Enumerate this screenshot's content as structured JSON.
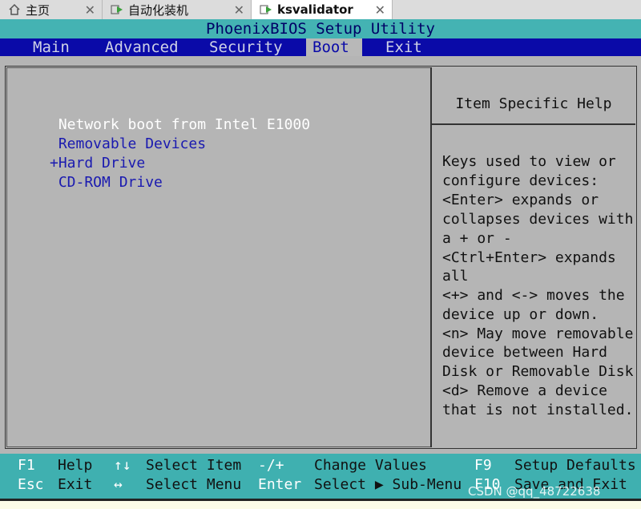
{
  "tabs": [
    {
      "label": "主页"
    },
    {
      "label": "自动化装机"
    },
    {
      "label": "ksvalidator"
    }
  ],
  "bios": {
    "title": "PhoenixBIOS Setup Utility",
    "menu": [
      {
        "label": "Main"
      },
      {
        "label": "Advanced"
      },
      {
        "label": "Security"
      },
      {
        "label": "Boot"
      },
      {
        "label": "Exit"
      }
    ],
    "active_menu": "Boot",
    "boot_items": [
      {
        "label": " Network boot from Intel E1000"
      },
      {
        "label": " Removable Devices"
      },
      {
        "label": "+Hard Drive"
      },
      {
        "label": " CD-ROM Drive"
      }
    ],
    "help": {
      "title": "Item Specific Help",
      "lines": [
        "Keys used to view or",
        "configure devices:",
        "<Enter> expands or",
        "collapses devices with",
        "a + or -",
        "<Ctrl+Enter> expands",
        "all",
        "<+> and <-> moves the",
        "device up or down.",
        "<n> May move removable",
        "device between Hard",
        "Disk or Removable Disk",
        "<d> Remove a device",
        "that is not installed."
      ]
    },
    "footer": {
      "row1": [
        {
          "key": "F1",
          "desc": "Help"
        },
        {
          "key": "↑↓",
          "desc": "Select Item"
        },
        {
          "key": "-/+",
          "desc": "Change Values"
        },
        {
          "key": "F9",
          "desc": "Setup Defaults"
        }
      ],
      "row2": [
        {
          "key": "Esc",
          "desc": "Exit"
        },
        {
          "key": "↔",
          "desc": "Select Menu"
        },
        {
          "key": "Enter",
          "desc": "Select ▶ Sub-Menu"
        },
        {
          "key": "F10",
          "desc": "Save and Exit"
        }
      ]
    }
  },
  "watermark": "CSDN @qq_48722638"
}
